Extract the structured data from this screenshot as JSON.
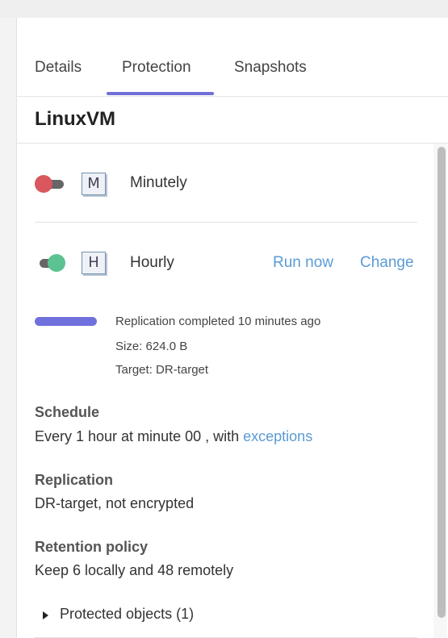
{
  "tabs": [
    {
      "label": "Details"
    },
    {
      "label": "Protection"
    },
    {
      "label": "Snapshots"
    }
  ],
  "active_tab": "Protection",
  "vm_name": "LinuxVM",
  "minutely": {
    "badge": "M",
    "label": "Minutely",
    "enabled": false
  },
  "hourly": {
    "badge": "H",
    "label": "Hourly",
    "enabled": true,
    "run_now": "Run now",
    "change": "Change",
    "status": "Replication completed 10 minutes ago",
    "size": "Size: 624.0 B",
    "target": "Target: DR-target",
    "progress": 1.0
  },
  "schedule": {
    "heading": "Schedule",
    "text": "Every 1 hour at minute 00 , with",
    "link": "exceptions"
  },
  "replication": {
    "heading": "Replication",
    "value": "DR-target, not encrypted"
  },
  "retention": {
    "heading": "Retention policy",
    "value": "Keep 6 locally and 48 remotely"
  },
  "protected_objects": {
    "label": "Protected objects (1)"
  },
  "colors": {
    "accent": "#6f6fd9",
    "link": "#5b9bd5",
    "toggle_off": "#d9575d",
    "toggle_on": "#5ac391"
  }
}
